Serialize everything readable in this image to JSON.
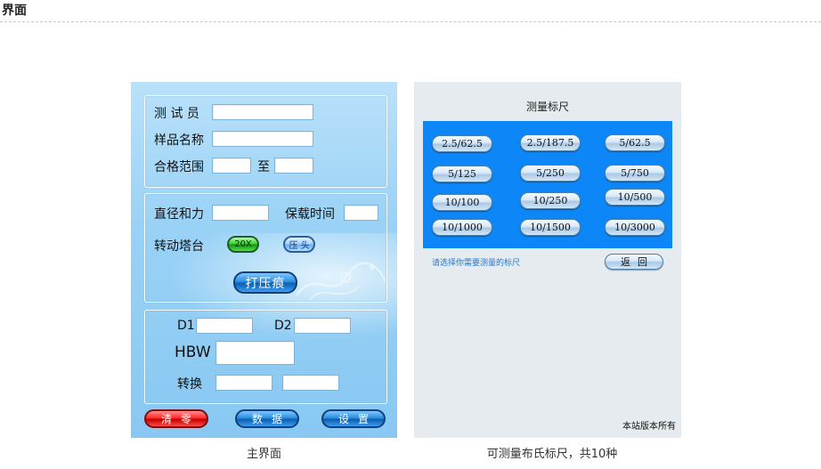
{
  "page": {
    "heading": "界面"
  },
  "main_screen": {
    "fields": {
      "tester": "测 试 员",
      "sample_name": "样品名称",
      "pass_range": "合格范围",
      "range_to": "至",
      "diameter_force": "直径和力",
      "hold_time": "保载时间",
      "turret": "转动塔台",
      "d1": "D1",
      "d2": "D2",
      "hbw": "HBW",
      "convert": "转换"
    },
    "buttons": {
      "zoom": "20X",
      "indenter": "压头",
      "make_indent": "打压痕",
      "clear": "清零",
      "data": "数据",
      "settings": "设置"
    },
    "caption": "主界面"
  },
  "ruler_screen": {
    "title": "测量标尺",
    "rulers": [
      "2.5/62.5",
      "2.5/187.5",
      "5/62.5",
      "5/125",
      "5/250",
      "5/750",
      "10/100",
      "10/250",
      "10/500",
      "10/1000",
      "10/1500",
      "10/3000"
    ],
    "hint": "请选择你需要测量的标尺",
    "back_button": "返回",
    "copyright": "本站版本所有",
    "caption": "可测量布氏标尺，共10种"
  },
  "colors": {
    "ruler_area": "#0d87f7",
    "left_panel": "#9ad2f6",
    "right_panel": "#e5ebef"
  }
}
